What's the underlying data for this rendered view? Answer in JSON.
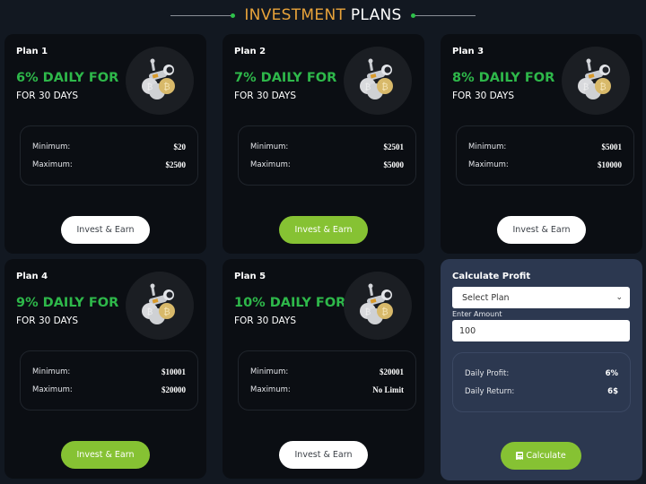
{
  "heading": {
    "accent": "INVESTMENT",
    "plain": "PLANS"
  },
  "plans": [
    {
      "name": "Plan 1",
      "rate": "6% DAILY FOR",
      "duration": "FOR 30 DAYS",
      "min_label": "Minimum:",
      "min": "$20",
      "max_label": "Maximum:",
      "max": "$2500",
      "button": "Invest & Earn",
      "button_style": "white"
    },
    {
      "name": "Plan 2",
      "rate": "7% DAILY FOR",
      "duration": "FOR 30 DAYS",
      "min_label": "Minimum:",
      "min": "$2501",
      "max_label": "Maximum:",
      "max": "$5000",
      "button": "Invest & Earn",
      "button_style": "green"
    },
    {
      "name": "Plan 3",
      "rate": "8% DAILY FOR",
      "duration": "FOR 30 DAYS",
      "min_label": "Minimum:",
      "min": "$5001",
      "max_label": "Maximum:",
      "max": "$10000",
      "button": "Invest & Earn",
      "button_style": "white"
    },
    {
      "name": "Plan 4",
      "rate": "9% DAILY FOR",
      "duration": "FOR 30 DAYS",
      "min_label": "Minimum:",
      "min": "$10001",
      "max_label": "Maximum:",
      "max": "$20000",
      "button": "Invest & Earn",
      "button_style": "green"
    },
    {
      "name": "Plan 5",
      "rate": "10% DAILY FOR",
      "duration": "FOR 30 DAYS",
      "min_label": "Minimum:",
      "min": "$20001",
      "max_label": "Maximum:",
      "max": "No Limit",
      "button": "Invest & Earn",
      "button_style": "white"
    }
  ],
  "plan_icon": "astronaut-bitcoin-coins-icon",
  "calculator": {
    "title": "Calculate Profit",
    "select_value": "Select Plan",
    "amount_label": "Enter Amount",
    "amount_value": "100",
    "daily_profit_label": "Daily Profit:",
    "daily_profit_value": "6%",
    "daily_return_label": "Daily Return:",
    "daily_return_value": "6$",
    "button": "Calculate",
    "button_icon": "calculator-icon"
  },
  "colors": {
    "background": "#121821",
    "card": "#0b0e13",
    "calc_panel": "#2c3850",
    "rate_green": "#2eb84a",
    "button_green": "#86c233",
    "heading_accent": "#e8a33a"
  }
}
